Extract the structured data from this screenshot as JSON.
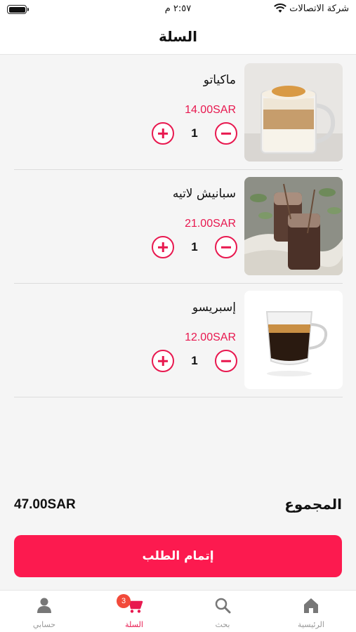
{
  "status_bar": {
    "carrier": "شركة الاتصالات",
    "time": "٢:٥٧ م"
  },
  "header": {
    "title": "السلة"
  },
  "cart": {
    "items": [
      {
        "name": "ماكياتو",
        "price": "14.00SAR",
        "quantity": "1",
        "image": "macchiato-glass"
      },
      {
        "name": "سبانيش لاتيه",
        "price": "21.00SAR",
        "quantity": "1",
        "image": "iced-spanish-latte-jars"
      },
      {
        "name": "إسبريسو",
        "price": "12.00SAR",
        "quantity": "1",
        "image": "espresso-glass-cup"
      }
    ]
  },
  "summary": {
    "total_label": "المجموع",
    "total_value": "47.00SAR"
  },
  "checkout": {
    "label": "إتمام الطلب"
  },
  "bottom_nav": {
    "items": [
      {
        "label": "الرئيسية",
        "icon": "home-icon"
      },
      {
        "label": "بحث",
        "icon": "search-icon"
      },
      {
        "label": "السلة",
        "icon": "cart-icon",
        "badge": "3",
        "active": true
      },
      {
        "label": "حسابي",
        "icon": "person-icon"
      }
    ]
  },
  "colors": {
    "accent": "#e8184f",
    "button": "#fc1a4f",
    "badge": "#f24a3a"
  }
}
